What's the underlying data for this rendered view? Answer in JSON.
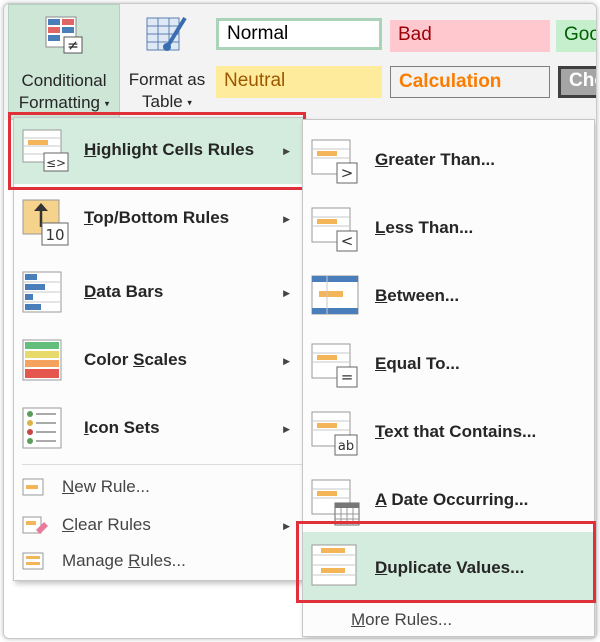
{
  "ribbon": {
    "conditional_formatting": {
      "line1": "Conditional",
      "line2": "Formatting"
    },
    "format_as_table": {
      "line1": "Format as",
      "line2": "Table"
    },
    "caret": "▾",
    "styles": {
      "normal": "Normal",
      "bad": "Bad",
      "good": "Goo",
      "neutral": "Neutral",
      "calculation": "Calculation",
      "check": "Che"
    }
  },
  "main_menu": {
    "items": [
      {
        "u": "H",
        "rest": "ighlight Cells Rules",
        "icon": "highlight-cells-icon"
      },
      {
        "u": "T",
        "rest": "op/Bottom Rules",
        "icon": "top-bottom-icon"
      },
      {
        "u": "D",
        "rest": "ata Bars",
        "icon": "data-bars-icon"
      },
      {
        "pre": "Color ",
        "u": "S",
        "rest": "cales",
        "icon": "color-scales-icon"
      },
      {
        "u": "I",
        "rest": "con Sets",
        "icon": "icon-sets-icon"
      }
    ],
    "small_items": [
      {
        "u": "N",
        "rest": "ew Rule...",
        "icon": "new-rule-icon"
      },
      {
        "u": "C",
        "rest": "lear Rules",
        "icon": "clear-rules-icon"
      },
      {
        "pre": "Manage ",
        "u": "R",
        "rest": "ules...",
        "icon": "manage-rules-icon"
      }
    ],
    "arrow": "▶"
  },
  "sub_menu": {
    "items": [
      {
        "u": "G",
        "rest": "reater Than...",
        "icon": "greater-than-icon",
        "glyph": ">"
      },
      {
        "u": "L",
        "rest": "ess Than...",
        "icon": "less-than-icon",
        "glyph": "<"
      },
      {
        "u": "B",
        "rest": "etween...",
        "icon": "between-icon"
      },
      {
        "u": "E",
        "rest": "qual To...",
        "icon": "equal-to-icon",
        "glyph": "="
      },
      {
        "u": "T",
        "rest": "ext that Contains...",
        "icon": "text-contains-icon",
        "glyph": "ab"
      },
      {
        "u": "A",
        "rest": " Date Occurring...",
        "icon": "date-occurring-icon"
      },
      {
        "u": "D",
        "rest": "uplicate Values...",
        "icon": "duplicate-values-icon"
      }
    ],
    "more": {
      "u": "M",
      "rest": "ore Rules..."
    }
  },
  "colors": {
    "accent": "#d3ecdd",
    "highlight_border": "#e0313b"
  }
}
